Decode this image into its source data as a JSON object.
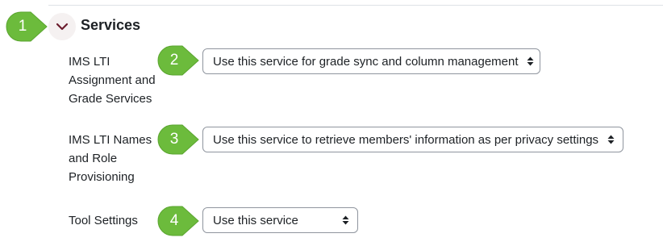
{
  "section": {
    "title": "Services",
    "toggle_icon": "chevron-down-icon"
  },
  "fields": [
    {
      "label": "IMS LTI Assignment and Grade Services",
      "value": "Use this service for grade sync and column management"
    },
    {
      "label": "IMS LTI Names and Role Provisioning",
      "value": "Use this service to retrieve members' information as per privacy settings"
    },
    {
      "label": "Tool Settings",
      "value": "Use this service"
    }
  ],
  "callouts": [
    "1",
    "2",
    "3",
    "4"
  ],
  "colors": {
    "callout_green": "#6cbb3c",
    "accent_maroon": "#6b1d2e",
    "border": "#8f959e"
  }
}
